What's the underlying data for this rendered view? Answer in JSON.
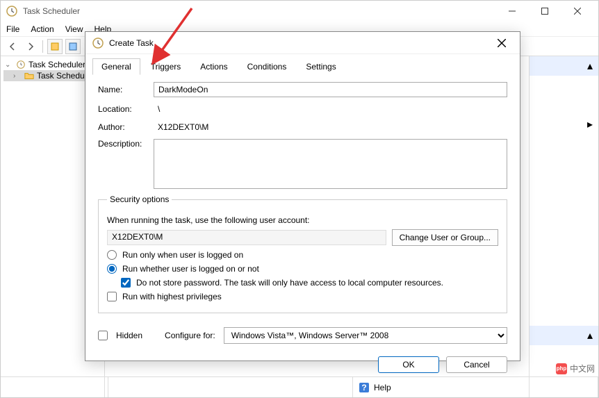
{
  "main": {
    "title": "Task Scheduler",
    "menus": [
      "File",
      "Action",
      "View",
      "Help"
    ],
    "tree": {
      "root": "Task Scheduler (L",
      "child": "Task Schedule"
    },
    "status_help": "Help"
  },
  "dialog": {
    "title": "Create Task",
    "tabs": [
      "General",
      "Triggers",
      "Actions",
      "Conditions",
      "Settings"
    ],
    "labels": {
      "name": "Name:",
      "location": "Location:",
      "author": "Author:",
      "description": "Description:"
    },
    "values": {
      "name": "DarkModeOn",
      "location": "\\",
      "author": "X12DEXT0\\M",
      "description": ""
    },
    "security": {
      "legend": "Security options",
      "prompt": "When running the task, use the following user account:",
      "account": "X12DEXT0\\M",
      "change_btn": "Change User or Group...",
      "radio_logged_on": "Run only when user is logged on",
      "radio_logged_on_or_not": "Run whether user is logged on or not",
      "no_password": "Do not store password.  The task will only have access to local computer resources.",
      "highest_priv": "Run with highest privileges"
    },
    "bottom": {
      "hidden": "Hidden",
      "configure_for": "Configure for:",
      "configure_value": "Windows Vista™, Windows Server™ 2008"
    },
    "buttons": {
      "ok": "OK",
      "cancel": "Cancel"
    }
  },
  "watermark": "中文网"
}
